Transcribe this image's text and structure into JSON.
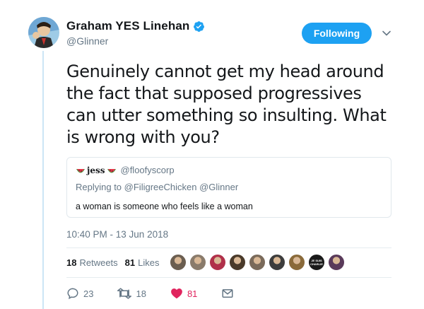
{
  "tweet": {
    "author_name": "Graham YES Linehan",
    "author_handle": "@Glinner",
    "follow_label": "Following",
    "text": "Genuinely cannot get my head around the fact that supposed progressives can utter something so insulting. What is wrong with you?",
    "timestamp": "10:40 PM - 13 Jun 2018"
  },
  "quote": {
    "name": "jess",
    "handle": "@floofyscorp",
    "replying_prefix": "Replying to",
    "replying_to": "@FiligreeChicken @Glinner",
    "text": "a woman is someone who feels like a woman"
  },
  "stats": {
    "retweets_count": "18",
    "retweets_label": "Retweets",
    "likes_count": "81",
    "likes_label": "Likes"
  },
  "actions": {
    "replies": "23",
    "retweets": "18",
    "likes": "81"
  },
  "likers": [
    {
      "color": "#6b5e50"
    },
    {
      "color": "#8a7b6b"
    },
    {
      "color": "#b0304a"
    },
    {
      "color": "#4a3a2a"
    },
    {
      "color": "#7a6a5a"
    },
    {
      "color": "#3d3d3d"
    },
    {
      "color": "#8a6a3a"
    },
    {
      "color": "#1a1a1a"
    },
    {
      "color": "#5a3a5a"
    }
  ],
  "liker_badge_text": "JE SUIS CHARLIE",
  "colors": {
    "accent": "#1da1f2",
    "like": "#e0245e",
    "muted": "#657786",
    "thread_line": "#cce6f6"
  }
}
